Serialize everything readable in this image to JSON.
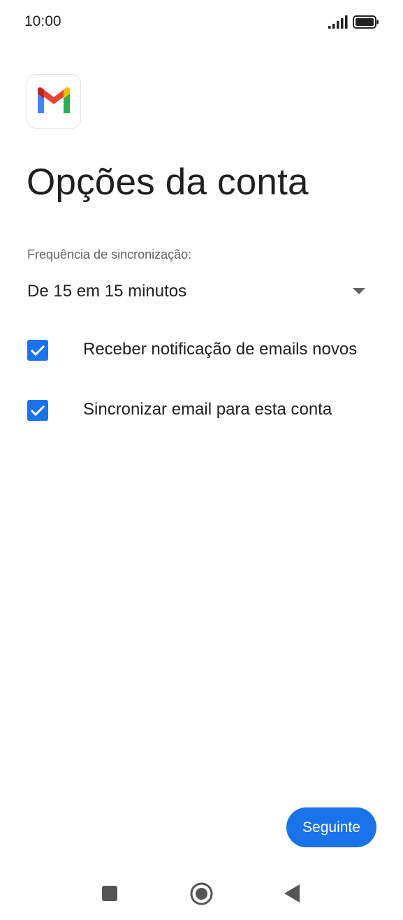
{
  "status_bar": {
    "time": "10:00",
    "icons": [
      "signal-icon",
      "battery-icon"
    ]
  },
  "app": {
    "logo_icon": "gmail-logo-icon",
    "title": "Opções da conta"
  },
  "sync": {
    "label": "Frequência de sincronização:",
    "value": "De 15 em 15 minutos"
  },
  "options": [
    {
      "label": "Receber notificação de emails novos",
      "checked": true
    },
    {
      "label": "Sincronizar email para esta conta",
      "checked": true
    }
  ],
  "next_button": {
    "label": "Seguinte"
  },
  "nav_bar": {
    "icons": [
      "recents-icon",
      "home-icon",
      "back-icon"
    ]
  },
  "colors": {
    "accent": "#1a73e8",
    "text": "#1f1f1f",
    "secondary_text": "#5f6368"
  }
}
